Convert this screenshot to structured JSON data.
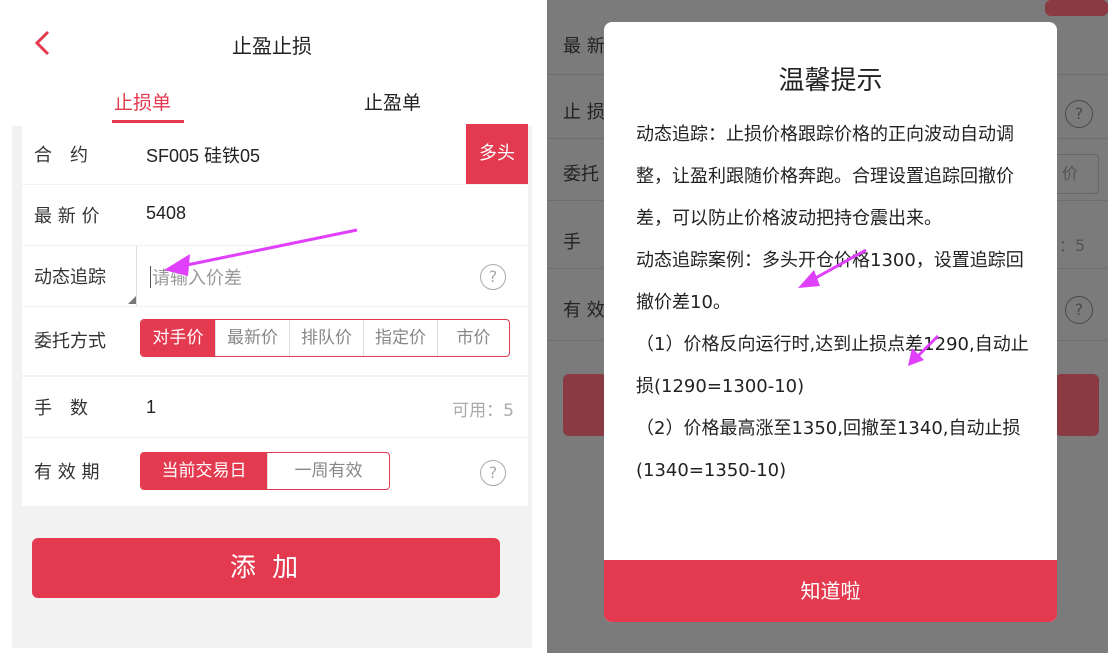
{
  "left": {
    "title": "止盈止损",
    "tabs": [
      {
        "label": "止损单",
        "active": true
      },
      {
        "label": "止盈单",
        "active": false
      }
    ],
    "contract": {
      "label": "合　约",
      "value": "SF005 硅铁05",
      "side": "多头"
    },
    "latest_price": {
      "label": "最 新 价",
      "value": "5408"
    },
    "dynamic_trace": {
      "label": "动态追踪",
      "placeholder": "请输入价差"
    },
    "order_type": {
      "label": "委托方式",
      "options": [
        "对手价",
        "最新价",
        "排队价",
        "指定价",
        "市价"
      ],
      "selected": "对手价"
    },
    "lots": {
      "label": "手　数",
      "value": "1",
      "available": "可用：5"
    },
    "validity": {
      "label": "有 效 期",
      "options": [
        "当前交易日",
        "一周有效"
      ],
      "selected": "当前交易日"
    },
    "help_glyph": "?",
    "submit_label": "添 加"
  },
  "right": {
    "background_rows": [
      "最 新",
      "止 损",
      "委托",
      "手",
      "有 效"
    ],
    "background_fragments": {
      "price_btn": "价",
      "avail": "：5"
    },
    "dialog": {
      "title": "温馨提示",
      "paragraphs": [
        "动态追踪：止损价格跟踪价格的正向波动自动调整，让盈利跟随价格奔跑。合理设置追踪回撤价差，可以防止价格波动把持仓震出来。",
        "动态追踪案例：多头开仓价格1300，设置追踪回撤价差10。",
        "（1）价格反向运行时,达到止损点差1290,自动止损(1290=1300-10)",
        "（2）价格最高涨至1350,回撤至1340,自动止损(1340=1350-10)"
      ],
      "button": "知道啦"
    }
  },
  "colors": {
    "accent": "#e33a4f",
    "arrow": "#e040fb",
    "overlay": "#7b7b7b"
  }
}
